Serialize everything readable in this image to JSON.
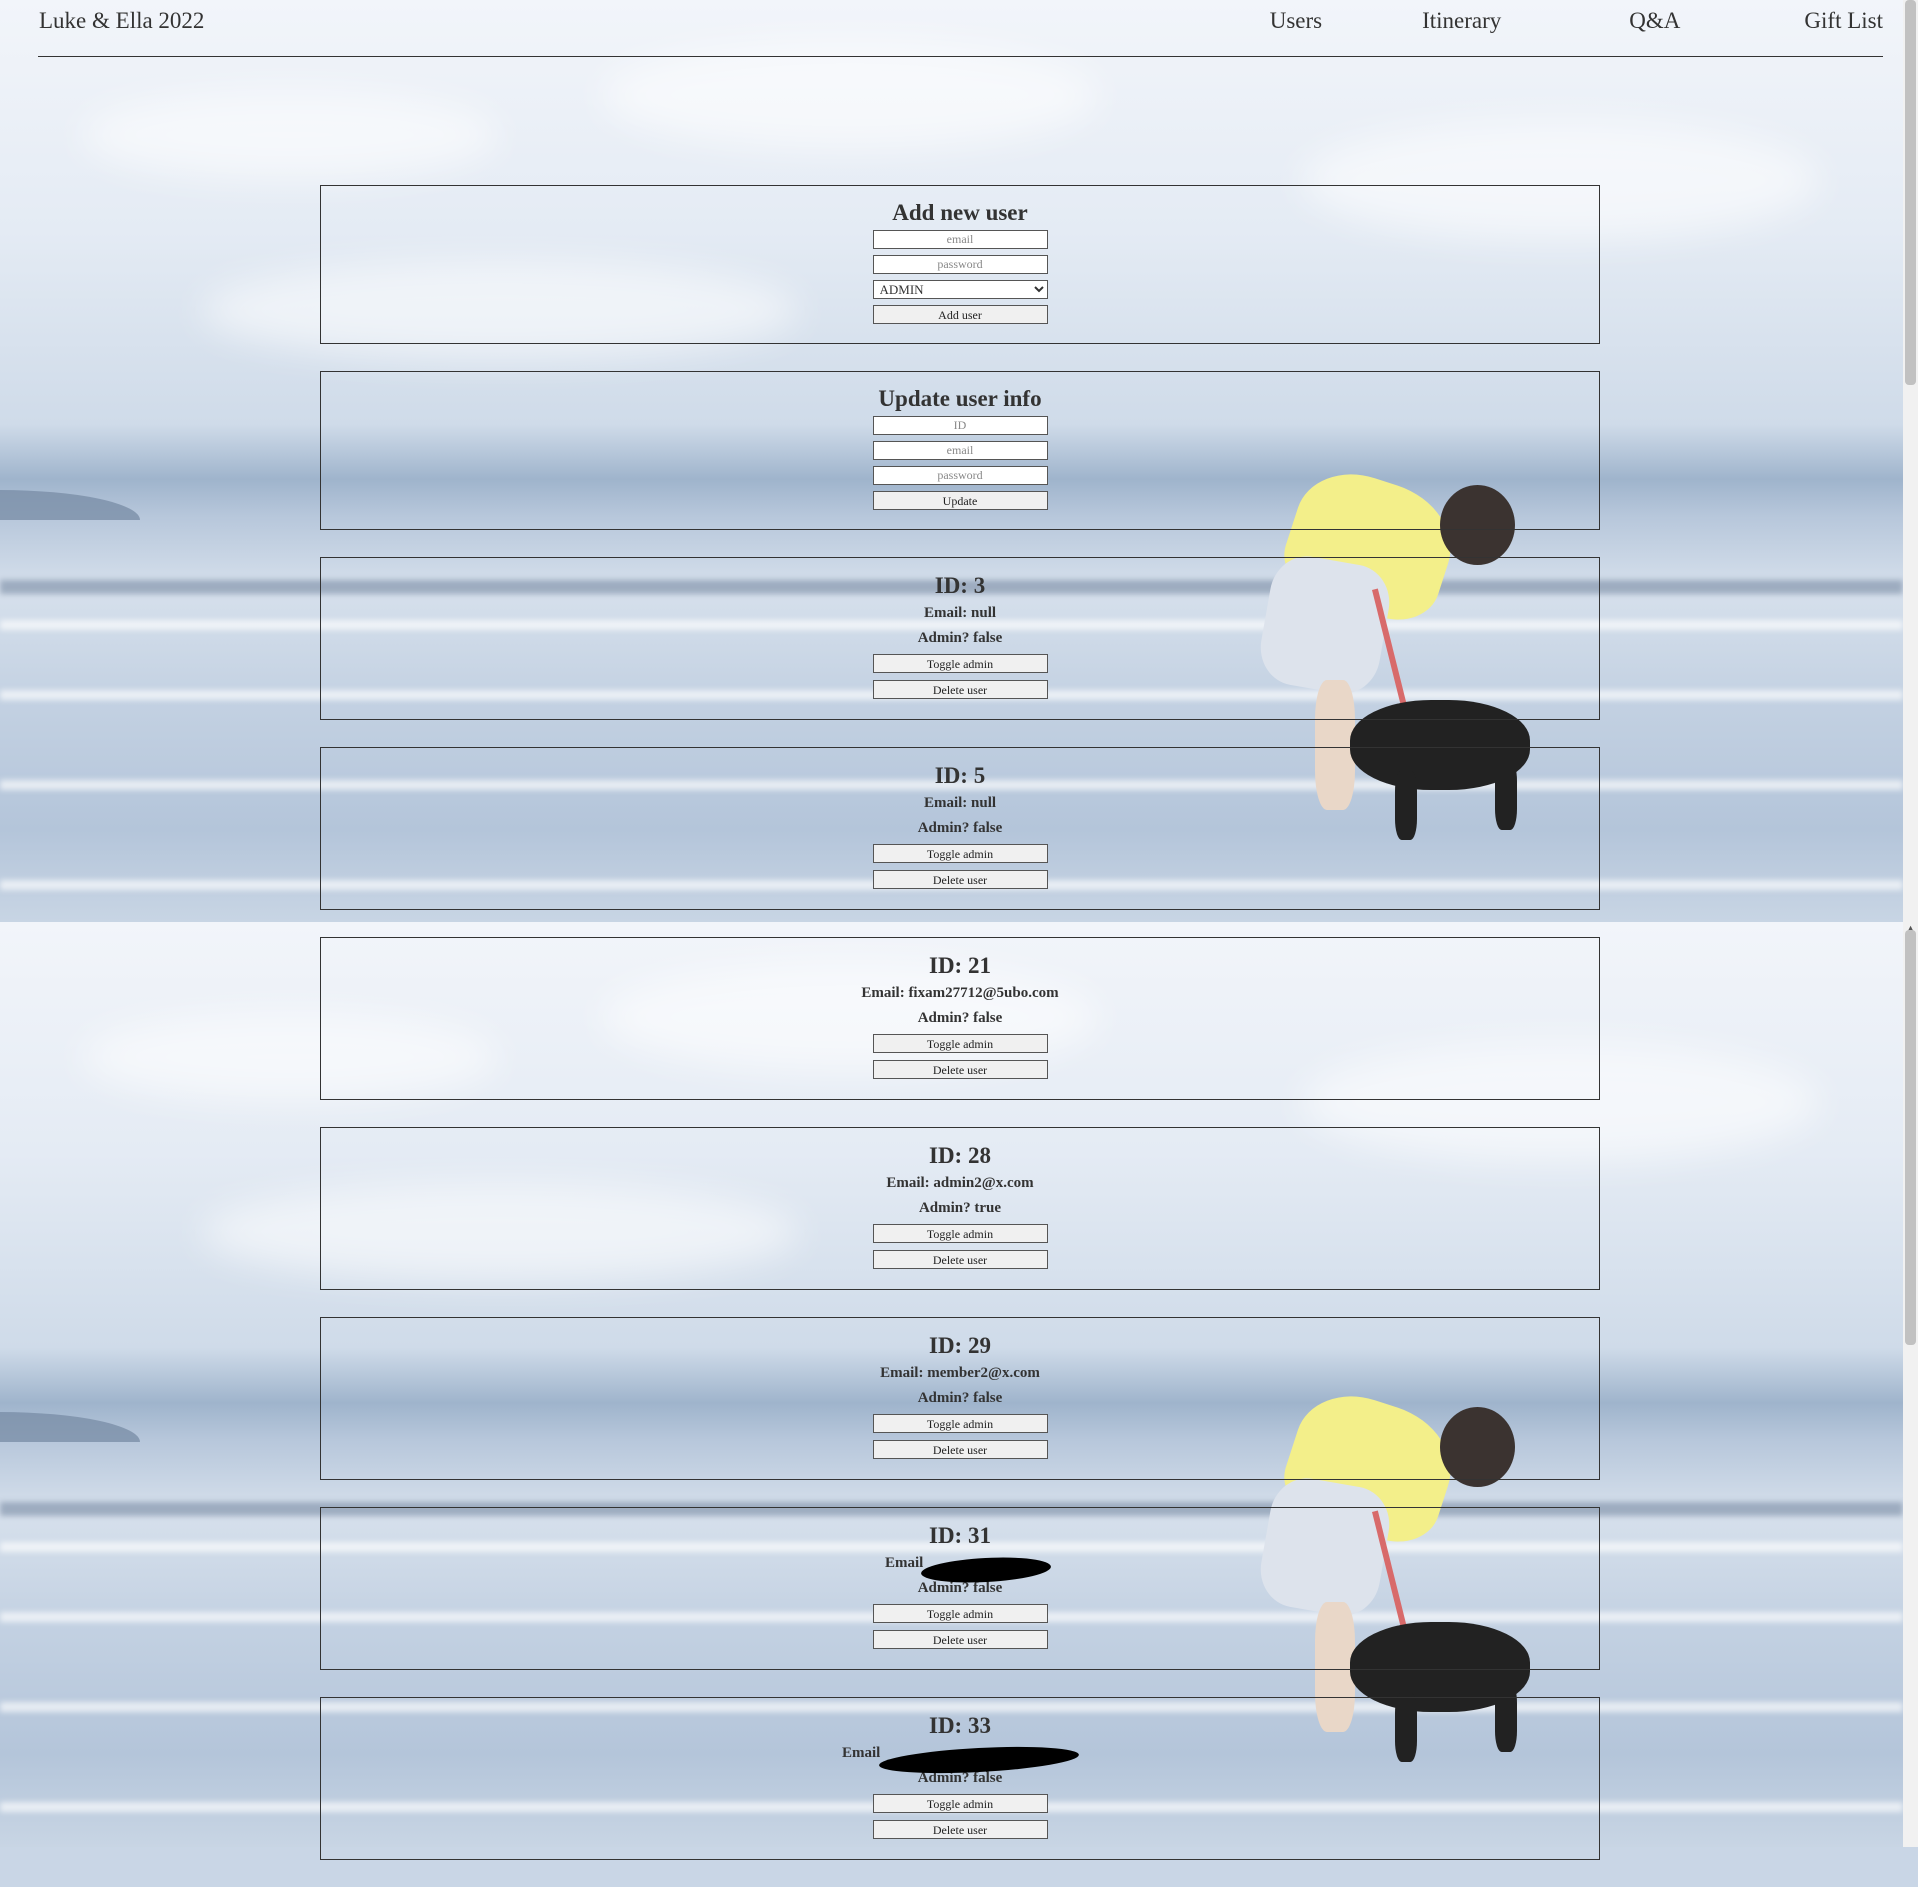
{
  "site": {
    "title": "Luke & Ella 2022",
    "nav": [
      "Users",
      "Itinerary",
      "Q&A",
      "Gift List"
    ]
  },
  "add_user": {
    "heading": "Add new user",
    "email_placeholder": "email",
    "password_placeholder": "password",
    "role_selected": "ADMIN",
    "button": "Add user"
  },
  "update_user": {
    "heading": "Update user info",
    "id_placeholder": "ID",
    "email_placeholder": "email",
    "password_placeholder": "password",
    "button": "Update"
  },
  "users": [
    {
      "id": "ID: 3",
      "email": "Email: null",
      "admin": "Admin? false",
      "toggle": "Toggle admin",
      "delete": "Delete user"
    },
    {
      "id": "ID: 5",
      "email": "Email: null",
      "admin": "Admin? false",
      "toggle": "Toggle admin",
      "delete": "Delete user"
    },
    {
      "id": "ID: 21",
      "email": "Email: fixam27712@5ubo.com",
      "admin": "Admin? false",
      "toggle": "Toggle admin",
      "delete": "Delete user"
    },
    {
      "id": "ID: 28",
      "email": "Email: admin2@x.com",
      "admin": "Admin? true",
      "toggle": "Toggle admin",
      "delete": "Delete user"
    },
    {
      "id": "ID: 29",
      "email": "Email: member2@x.com",
      "admin": "Admin? false",
      "toggle": "Toggle admin",
      "delete": "Delete user"
    },
    {
      "id": "ID: 31",
      "email": "Email",
      "admin": "Admin? false",
      "toggle": "Toggle admin",
      "delete": "Delete user"
    },
    {
      "id": "ID: 33",
      "email": "Email",
      "admin": "Admin? false",
      "toggle": "Toggle admin",
      "delete": "Delete user"
    }
  ]
}
